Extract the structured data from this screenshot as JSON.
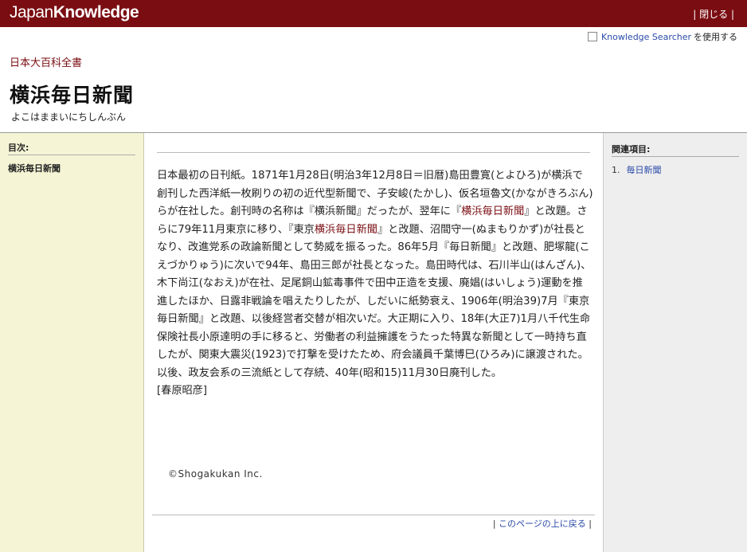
{
  "header": {
    "logo_japan": "Japan",
    "logo_knowledge": "Knowledge",
    "close_label": "| 閉じる |"
  },
  "knowledge_searcher": {
    "link": "Knowledge Searcher",
    "suffix": "を使用する",
    "checked": false
  },
  "article": {
    "category": "日本大百科全書",
    "title": "横浜毎日新聞",
    "reading": "よこはままいにちしんぶん"
  },
  "toc": {
    "heading": "目次:",
    "items": [
      "横浜毎日新聞"
    ]
  },
  "body": {
    "p1": "日本最初の日刊紙。1871年1月28日(明治3年12月8日＝旧暦)島田豊寛(とよひろ)が横浜で創刊した西洋紙一枚刷りの初の近代型新聞で、子安峻(たかし)、仮名垣魯文(かながきろぶん)らが在社した。創刊時の名称は『横浜新聞』だったが、翌年に『",
    "link1": "横浜毎日新聞",
    "p2": "』と改題。さらに79年11月東京に移り、『東京",
    "link2": "横浜毎日新聞",
    "p3": "』と改題、沼間守一(ぬまもりかず)が社長となり、改進党系の政論新聞として勢威を振るった。86年5月『毎日新聞』と改題、肥塚龍(こえづかりゅう)に次いで94年、島田三郎が社長となった。島田時代は、石川半山(はんざん)、木下尚江(なおえ)が在社、足尾銅山鉱毒事件で田中正造を支援、廃娼(はいしょう)運動を推進したほか、日露非戦論を唱えたりしたが、しだいに紙勢衰え、1906年(明治39)7月『東京毎日新聞』と改題、以後経営者交替が相次いだ。大正期に入り、18年(大正7)1月八千代生命保険社長小原達明の手に移ると、労働者の利益擁護をうたった特異な新聞として一時持ち直したが、関東大震災(1923)で打撃を受けたため、府会議員千葉博巳(ひろみ)に譲渡された。以後、政友会系の三流紙として存続、40年(昭和15)11月30日廃刊した。",
    "author": "[春原昭彦]"
  },
  "copyright": "©Shogakukan Inc.",
  "footer": {
    "back_to_top": "このページの上に戻る"
  },
  "related": {
    "heading": "関連項目:",
    "items": [
      {
        "num": "1.",
        "label": "毎日新聞"
      }
    ]
  }
}
